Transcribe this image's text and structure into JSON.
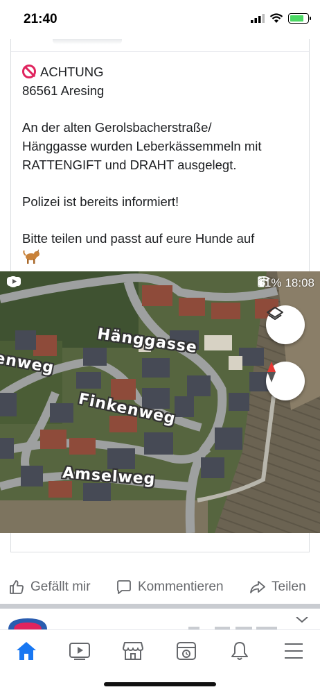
{
  "status_bar": {
    "time": "21:40"
  },
  "post": {
    "headline": "ACHTUNG",
    "location": "86561 Aresing",
    "body_line1": "An der alten Gerolsbacherstraße/",
    "body_line2": "Hänggasse wurden Leberkässemmeln mit",
    "body_line3": "RATTENGIFT und DRAHT ausgelegt.",
    "police_note": "Polizei ist bereits informiert!",
    "share_note": "Bitte teilen und passt auf eure Hunde auf"
  },
  "map_screenshot": {
    "battery_percent": "61%",
    "clock": "18:08",
    "streets": {
      "haenggasse": "Hänggasse",
      "weg_fragment": "enweg",
      "finkenweg": "Finkenweg",
      "amselweg": "Amselweg"
    },
    "buttons": [
      "layers-icon",
      "compass-icon"
    ]
  },
  "actions": {
    "like": "Gefällt mir",
    "comment": "Kommentieren",
    "share": "Teilen"
  },
  "tabs": [
    "home-icon",
    "watch-icon",
    "marketplace-icon",
    "memories-icon",
    "notifications-icon",
    "menu-icon"
  ],
  "colors": {
    "accent": "#1877f2",
    "icon_grey": "#65676b",
    "no_entry_red": "#e0245e"
  }
}
